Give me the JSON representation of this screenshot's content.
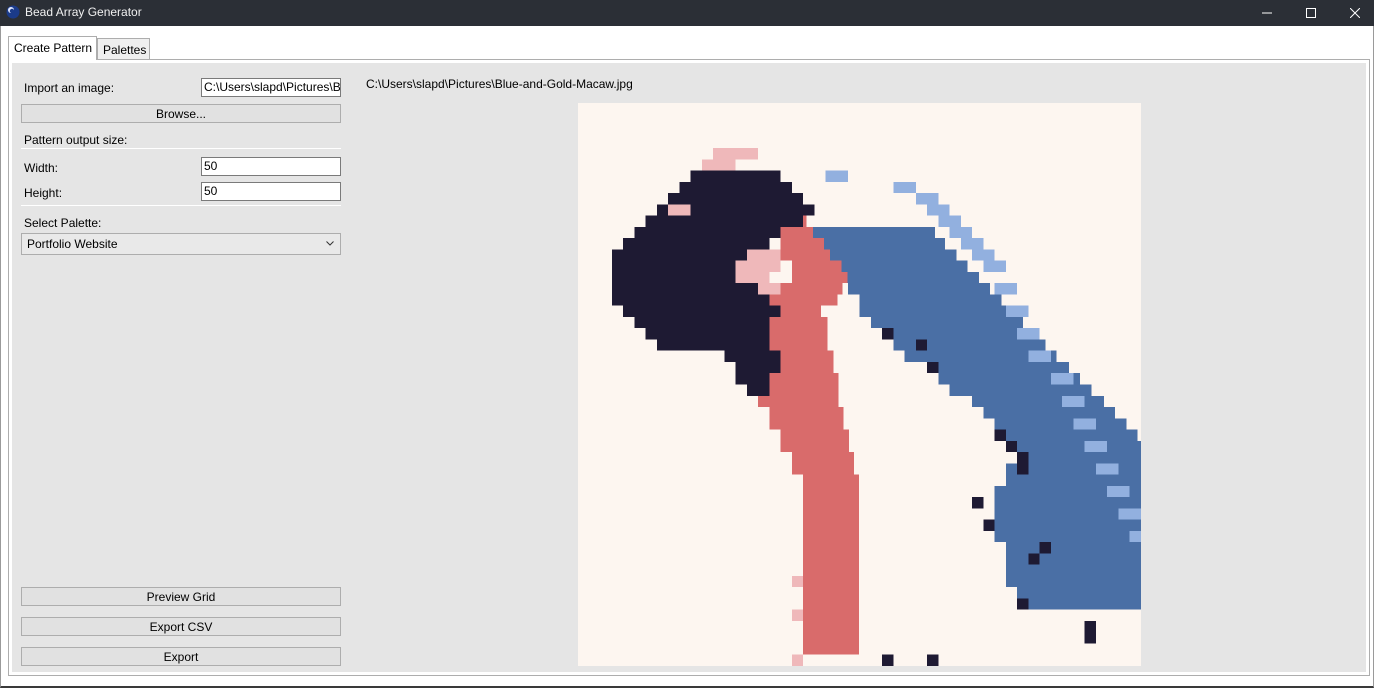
{
  "window": {
    "title": "Bead Array Generator"
  },
  "tabs": [
    {
      "label": "Create Pattern",
      "selected": true
    },
    {
      "label": "Palettes",
      "selected": false
    }
  ],
  "form": {
    "import_label": "Import an image:",
    "import_value": "C:\\Users\\slapd\\Pictures\\Bl",
    "browse_label": "Browse...",
    "output_size_label": "Pattern output size:",
    "width_label": "Width:",
    "width_value": "50",
    "height_label": "Height:",
    "height_value": "50",
    "palette_label": "Select Palette:",
    "palette_value": "Portfolio Website",
    "preview_label": "Preview Grid",
    "export_csv_label": "Export CSV",
    "export_label": "Export"
  },
  "image": {
    "path": "C:\\Users\\slapd\\Pictures\\Blue-and-Gold-Macaw.jpg"
  },
  "colors": {
    "background": "#fdf6f0",
    "navy": "#1e1a33",
    "blue": "#4a6fa5",
    "light_blue": "#92b0df",
    "coral": "#d96b6b",
    "pink": "#efb8ba",
    "title_bar": "#2b2f36"
  },
  "icons": {
    "app": "app-logo-icon",
    "minimize": "minimize-icon",
    "maximize": "maximize-icon",
    "close": "close-icon",
    "dropdown": "chevron-down-icon"
  }
}
